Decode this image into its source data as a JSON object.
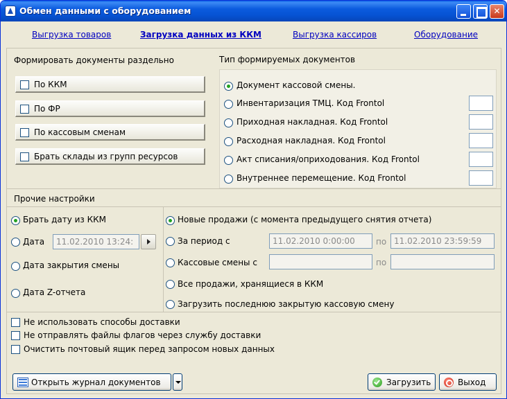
{
  "window": {
    "title": "Обмен данными с оборудованием"
  },
  "tabs": [
    {
      "label": "Выгрузка товаров"
    },
    {
      "label": "Загрузка данных из ККМ"
    },
    {
      "label": "Выгрузка кассиров"
    },
    {
      "label": "Оборудование"
    }
  ],
  "separate": {
    "title": "Формировать документы раздельно",
    "options": [
      {
        "label": "По ККМ",
        "checked": false
      },
      {
        "label": "По ФР",
        "checked": false
      },
      {
        "label": "По кассовым сменам",
        "checked": false
      },
      {
        "label": "Брать склады из групп ресурсов",
        "checked": false
      }
    ]
  },
  "doc_types": {
    "title": "Тип формируемых документов",
    "options": [
      {
        "label": "Документ кассовой смены.",
        "selected": true
      },
      {
        "label": "Инвентаризация ТМЦ. Код Frontol",
        "selected": false
      },
      {
        "label": "Приходная накладная. Код Frontol",
        "selected": false
      },
      {
        "label": "Расходная накладная. Код Frontol",
        "selected": false
      },
      {
        "label": "Акт списания/оприходования. Код Frontol",
        "selected": false
      },
      {
        "label": "Внутреннее перемещение. Код Frontol",
        "selected": false
      }
    ]
  },
  "other": {
    "title": "Прочие настройки",
    "date_options": [
      {
        "label": "Брать дату из ККМ",
        "selected": true
      },
      {
        "label": "Дата",
        "selected": false
      },
      {
        "label": "Дата закрытия смены",
        "selected": false
      },
      {
        "label": "Дата Z-отчета",
        "selected": false
      }
    ],
    "date_value": "11.02.2010 13:24:",
    "sales_options": [
      {
        "label": "Новые продажи (с момента предыдущего снятия отчета)",
        "selected": true
      },
      {
        "label": "За период с",
        "selected": false
      },
      {
        "label": "Кассовые смены с",
        "selected": false
      },
      {
        "label": "Все продажи, хранящиеся в ККМ",
        "selected": false
      },
      {
        "label": "Загрузить последнюю закрытую кассовую смену",
        "selected": false
      }
    ],
    "period_from": "11.02.2010 0:00:00",
    "period_to": "11.02.2010 23:59:59",
    "to_label": "по",
    "shift_to_label": "по"
  },
  "bottom_checks": [
    {
      "label": "Не использовать способы доставки",
      "checked": false
    },
    {
      "label": "Не отправлять файлы флагов через службу доставки",
      "checked": false
    },
    {
      "label": "Очистить почтовый ящик перед запросом новых данных",
      "checked": false
    }
  ],
  "buttons": {
    "journal": "Открыть журнал документов",
    "load": "Загрузить",
    "exit": "Выход"
  }
}
